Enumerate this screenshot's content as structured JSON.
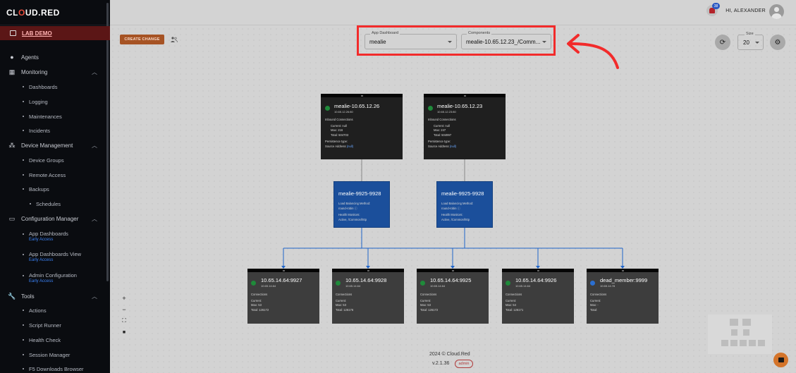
{
  "brand": {
    "name_a": "CL",
    "name_o": "O",
    "name_b": "UD.",
    "name_c": "RED"
  },
  "sidebar": {
    "lab": "LAB DEMO",
    "items": [
      {
        "label": "Agents",
        "icon": "palette-icon"
      },
      {
        "label": "Monitoring",
        "icon": "chart-icon"
      },
      {
        "label": "Dashboards"
      },
      {
        "label": "Logging"
      },
      {
        "label": "Maintenances"
      },
      {
        "label": "Incidents"
      },
      {
        "label": "Device Management",
        "icon": "devices-icon"
      },
      {
        "label": "Device Groups"
      },
      {
        "label": "Remote Access"
      },
      {
        "label": "Backups"
      },
      {
        "label": "Schedules"
      },
      {
        "label": "Configuration Manager",
        "icon": "monitor-icon"
      },
      {
        "label": "App Dashboards",
        "tag": "Early Access"
      },
      {
        "label": "App Dashboards View",
        "tag": "Early Access"
      },
      {
        "label": "Admin Configuration",
        "tag": "Early Access"
      },
      {
        "label": "Tools",
        "icon": "wrench-icon"
      },
      {
        "label": "Actions"
      },
      {
        "label": "Script Runner"
      },
      {
        "label": "Health Check"
      },
      {
        "label": "Session Manager"
      },
      {
        "label": "F5 Downloads Browser"
      }
    ]
  },
  "header": {
    "greeting": "HI, ALEXANDER",
    "notifications": "38"
  },
  "toolbar": {
    "create_change": "CREATE CHANGE",
    "app_dashboard_label": "App Dashboard",
    "app_dashboard_value": "mealie",
    "components_label": "Components",
    "components_value": "mealie-10.65.12.23_/Comm...",
    "size_label": "Size",
    "size_value": "20"
  },
  "nodes": {
    "vs1": {
      "title": "mealie-10.65.12.26",
      "ip": "10.65.12.26:80",
      "inbound": "Inbound Connections",
      "current": "Current: null",
      "max": "Max: 216",
      "total": "Total: 504703",
      "persistence": "Persistence type:",
      "source": "Source Address",
      "link": "(null)"
    },
    "vs2": {
      "title": "mealie-10.65.12.23",
      "ip": "10.65.12.23:80",
      "inbound": "Inbound Connections",
      "current": "Current: null",
      "max": "Max: 247",
      "total": "Total: 504997",
      "persistence": "Persistence type:",
      "source": "Source Address",
      "link": "(null)"
    },
    "pool1": {
      "title": "mealie-9925-9928",
      "lb": "Load Balancing Method:",
      "lb_val": "round-robin",
      "hm": "Health Monitors:",
      "hm_val": "Active, /Common/http"
    },
    "pool2": {
      "title": "mealie-9925-9928",
      "lb": "Load Balancing Method:",
      "lb_val": "round-robin",
      "hm": "Health Monitors:",
      "hm_val": "Active, /Common/http"
    },
    "m1": {
      "title": "10.65.14.64:9927",
      "ip": "10.65.14.64",
      "conn": "Connections",
      "current": "Current:",
      "max": "Max: 53",
      "total": "Total: 126172"
    },
    "m2": {
      "title": "10.65.14.64:9928",
      "ip": "10.65.14.64",
      "conn": "Connections",
      "current": "Current:",
      "max": "Max: 53",
      "total": "Total: 126176"
    },
    "m3": {
      "title": "10.65.14.64:9925",
      "ip": "10.65.14.64",
      "conn": "Connections",
      "current": "Current:",
      "max": "Max: 53",
      "total": "Total: 126172"
    },
    "m4": {
      "title": "10.65.14.64:9926",
      "ip": "10.65.14.64",
      "conn": "Connections",
      "current": "Current:",
      "max": "Max: 54",
      "total": "Total: 126171"
    },
    "m5": {
      "title": "dead_member:9999",
      "ip": "10.65.14.78",
      "conn": "Connections",
      "current": "Current:",
      "max": "Max: -",
      "total": "Total:"
    }
  },
  "footer": {
    "copyright": "2024 © Cloud.Red",
    "version": "v.2.1.36",
    "role": "admin"
  },
  "colors": {
    "accent": "#a65324",
    "status_up": "#1f8a3a",
    "status_unknown": "#2b6fd1",
    "highlight": "#f22b2b",
    "pool_blue": "#1b4f9b"
  }
}
